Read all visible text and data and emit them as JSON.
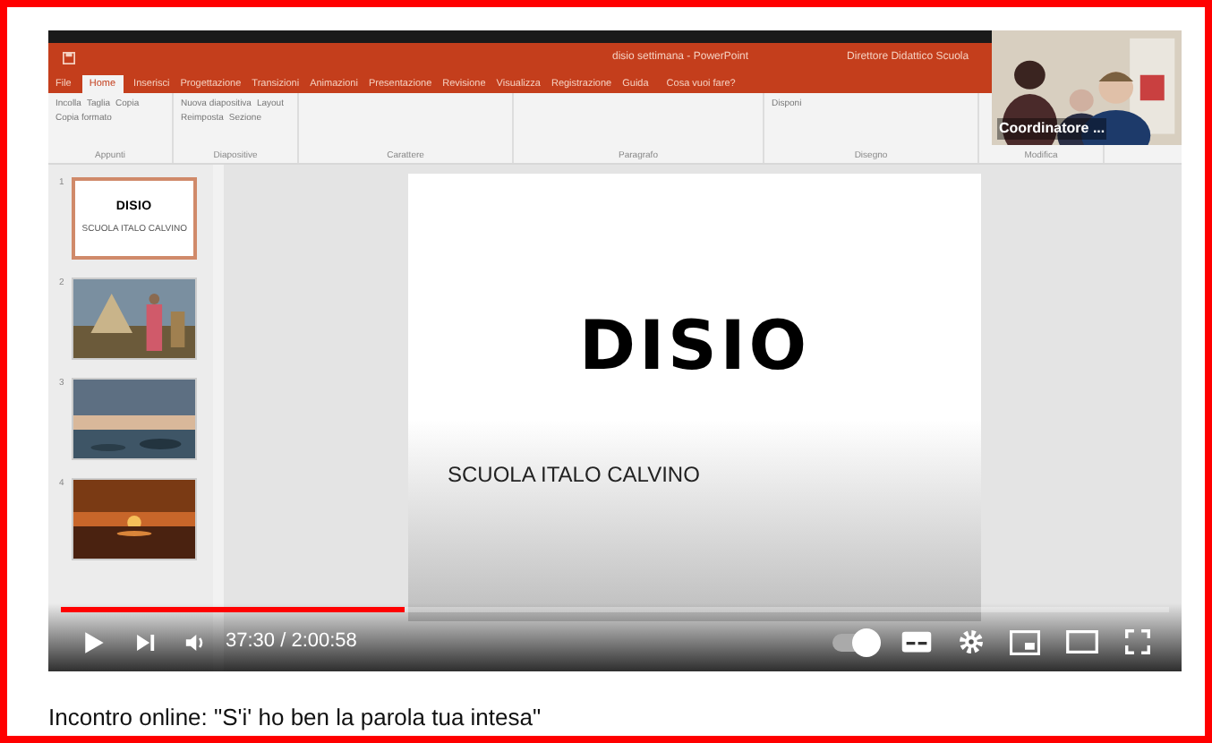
{
  "video": {
    "title_bar": {
      "filename": "disio settimana - PowerPoint",
      "user": "Direttore Didattico Scuola"
    },
    "ribbon_tabs": [
      {
        "label": "File",
        "selected": false
      },
      {
        "label": "Home",
        "selected": true
      },
      {
        "label": "Inserisci",
        "selected": false
      },
      {
        "label": "Progettazione",
        "selected": false
      },
      {
        "label": "Transizioni",
        "selected": false
      },
      {
        "label": "Animazioni",
        "selected": false
      },
      {
        "label": "Presentazione",
        "selected": false
      },
      {
        "label": "Revisione",
        "selected": false
      },
      {
        "label": "Visualizza",
        "selected": false
      },
      {
        "label": "Registrazione",
        "selected": false
      },
      {
        "label": "Guida",
        "selected": false
      }
    ],
    "tell_me": "Cosa vuoi fare?",
    "ribbon_groups": [
      {
        "label": "Appunti",
        "buttons": [
          "Incolla",
          "Taglia",
          "Copia",
          "Copia formato"
        ]
      },
      {
        "label": "Diapositive",
        "buttons": [
          "Nuova diapositiva",
          "Layout",
          "Reimposta",
          "Sezione"
        ]
      },
      {
        "label": "Carattere"
      },
      {
        "label": "Paragrafo"
      },
      {
        "label": "Disegno",
        "buttons": [
          "Disponi"
        ]
      },
      {
        "label": "Modifica"
      }
    ],
    "slides": [
      {
        "number": "1",
        "selected": true,
        "kind": "title",
        "title": "DISIO",
        "subtitle": "SCUOLA ITALO CALVINO"
      },
      {
        "number": "2",
        "selected": false,
        "kind": "picture"
      },
      {
        "number": "3",
        "selected": false,
        "kind": "picture"
      },
      {
        "number": "4",
        "selected": false,
        "kind": "picture"
      }
    ],
    "current_slide": {
      "title": "DISIO",
      "subtitle": "SCUOLA ITALO CALVINO"
    },
    "participant": {
      "name": "Coordinatore ..."
    }
  },
  "player": {
    "level": 0.31,
    "time": "37:30 / 2:00:58",
    "autoplay": true
  },
  "caption": "Incontro online: \"S'i' ho ben la parola tua intesa\""
}
